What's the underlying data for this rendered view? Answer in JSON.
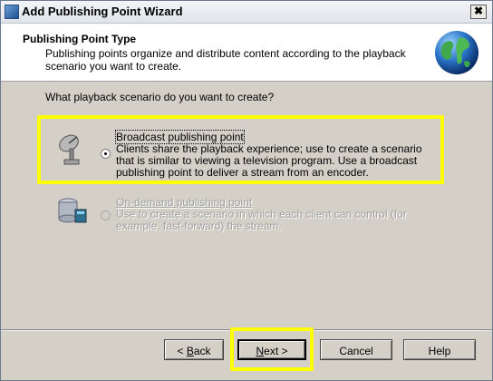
{
  "window": {
    "title": "Add Publishing Point Wizard",
    "close_label": "✖"
  },
  "header": {
    "title": "Publishing Point Type",
    "description": "Publishing points organize and distribute content according to the playback scenario you want to create."
  },
  "question": "What playback scenario do you want to create?",
  "options": [
    {
      "label": "Broadcast publishing point",
      "description": "Clients share the playback experience; use to create a scenario that is similar to viewing a television program. Use a broadcast publishing point to deliver a stream from an encoder.",
      "selected": true,
      "enabled": true,
      "icon": "satellite-dish-icon"
    },
    {
      "label": "On-demand publishing point",
      "description": "Use to create a scenario in which each client can control (for example, fast-forward) the stream.",
      "selected": false,
      "enabled": false,
      "icon": "server-disks-icon"
    }
  ],
  "buttons": {
    "back": {
      "before": "< ",
      "accel": "B",
      "after": "ack"
    },
    "next": {
      "accel": "N",
      "after": "ext >"
    },
    "cancel": "Cancel",
    "help": "Help"
  },
  "colors": {
    "highlight": "#ffff00",
    "dialog_bg": "#d4d0c8"
  }
}
